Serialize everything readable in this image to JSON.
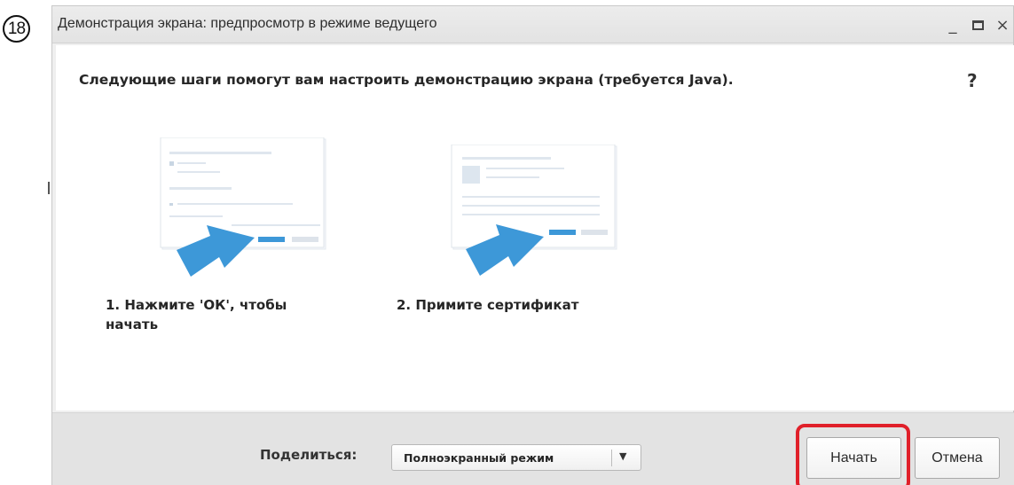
{
  "step_marker": "18",
  "dialog": {
    "title": "Демонстрация экрана: предпросмотр в режиме ведущего",
    "window_controls": {
      "minimize": "_",
      "close": "×"
    },
    "heading": "Следующие шаги помогут вам настроить демонстрацию экрана (требуется Java).",
    "help": "?",
    "steps": [
      {
        "label": "1. Нажмите 'ОК', чтобы начать"
      },
      {
        "label": "2. Примите сертификат"
      }
    ],
    "footer": {
      "share_label": "Поделиться:",
      "share_value": "Полноэкранный режим",
      "start_button": "Начать",
      "cancel_button": "Отмена"
    }
  },
  "colors": {
    "arrow": "#3d98d8",
    "highlight": "#e0202a",
    "footer_bg": "#e3e3e3"
  },
  "icons": [
    "minimize-icon",
    "maximize-icon",
    "close-icon",
    "help-icon",
    "dropdown-caret-icon",
    "arrow-pointer-icon"
  ]
}
